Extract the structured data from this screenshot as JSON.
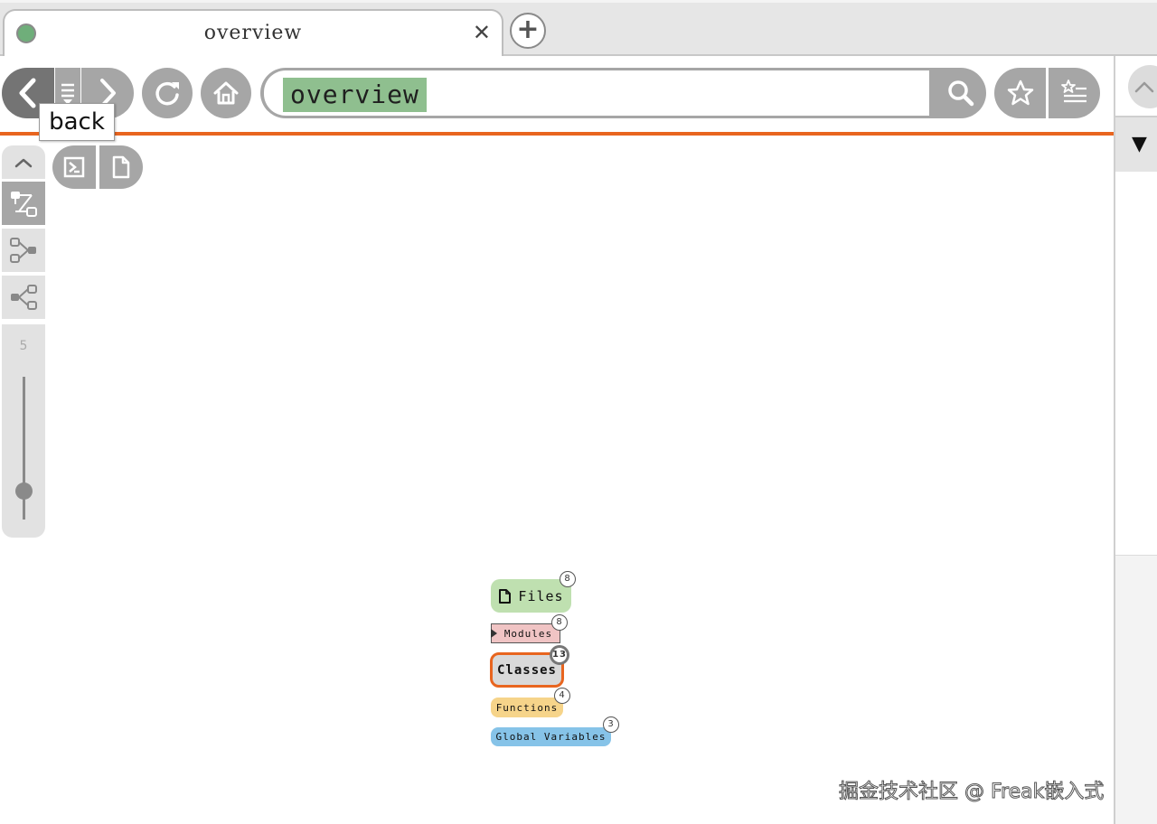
{
  "tab": {
    "title": "overview",
    "close_glyph": "✕",
    "status_dot_color": "#6fae7a"
  },
  "new_tab": {
    "glyph": "+"
  },
  "nav": {
    "back_tooltip": "back",
    "url_text": "overview",
    "icons": [
      "chevron-left-icon",
      "history-list-icon",
      "chevron-right-icon",
      "reload-icon",
      "home-icon",
      "search-icon",
      "star-icon",
      "bookmark-list-icon"
    ]
  },
  "side": {
    "slider_value": "5",
    "icons": [
      "chevron-up-icon",
      "tree-layout-icon",
      "graph-left-icon",
      "graph-right-icon",
      "terminal-icon",
      "document-icon"
    ]
  },
  "right_pane": {
    "menu_glyph": "▼",
    "icons": [
      "chevron-up-icon"
    ]
  },
  "nodes": [
    {
      "label": "Files",
      "count": "8",
      "color": "#bfe0b0"
    },
    {
      "label": "Modules",
      "count": "8",
      "color": "#f0c4c4"
    },
    {
      "label": "Classes",
      "count": "13",
      "color": "#d9d9d9"
    },
    {
      "label": "Functions",
      "count": "4",
      "color": "#f6d48a"
    },
    {
      "label": "Global Variables",
      "count": "3",
      "color": "#86c3e8"
    }
  ],
  "accent_color": "#e8651f",
  "watermark": "掘金技术社区 @ Freak嵌入式"
}
